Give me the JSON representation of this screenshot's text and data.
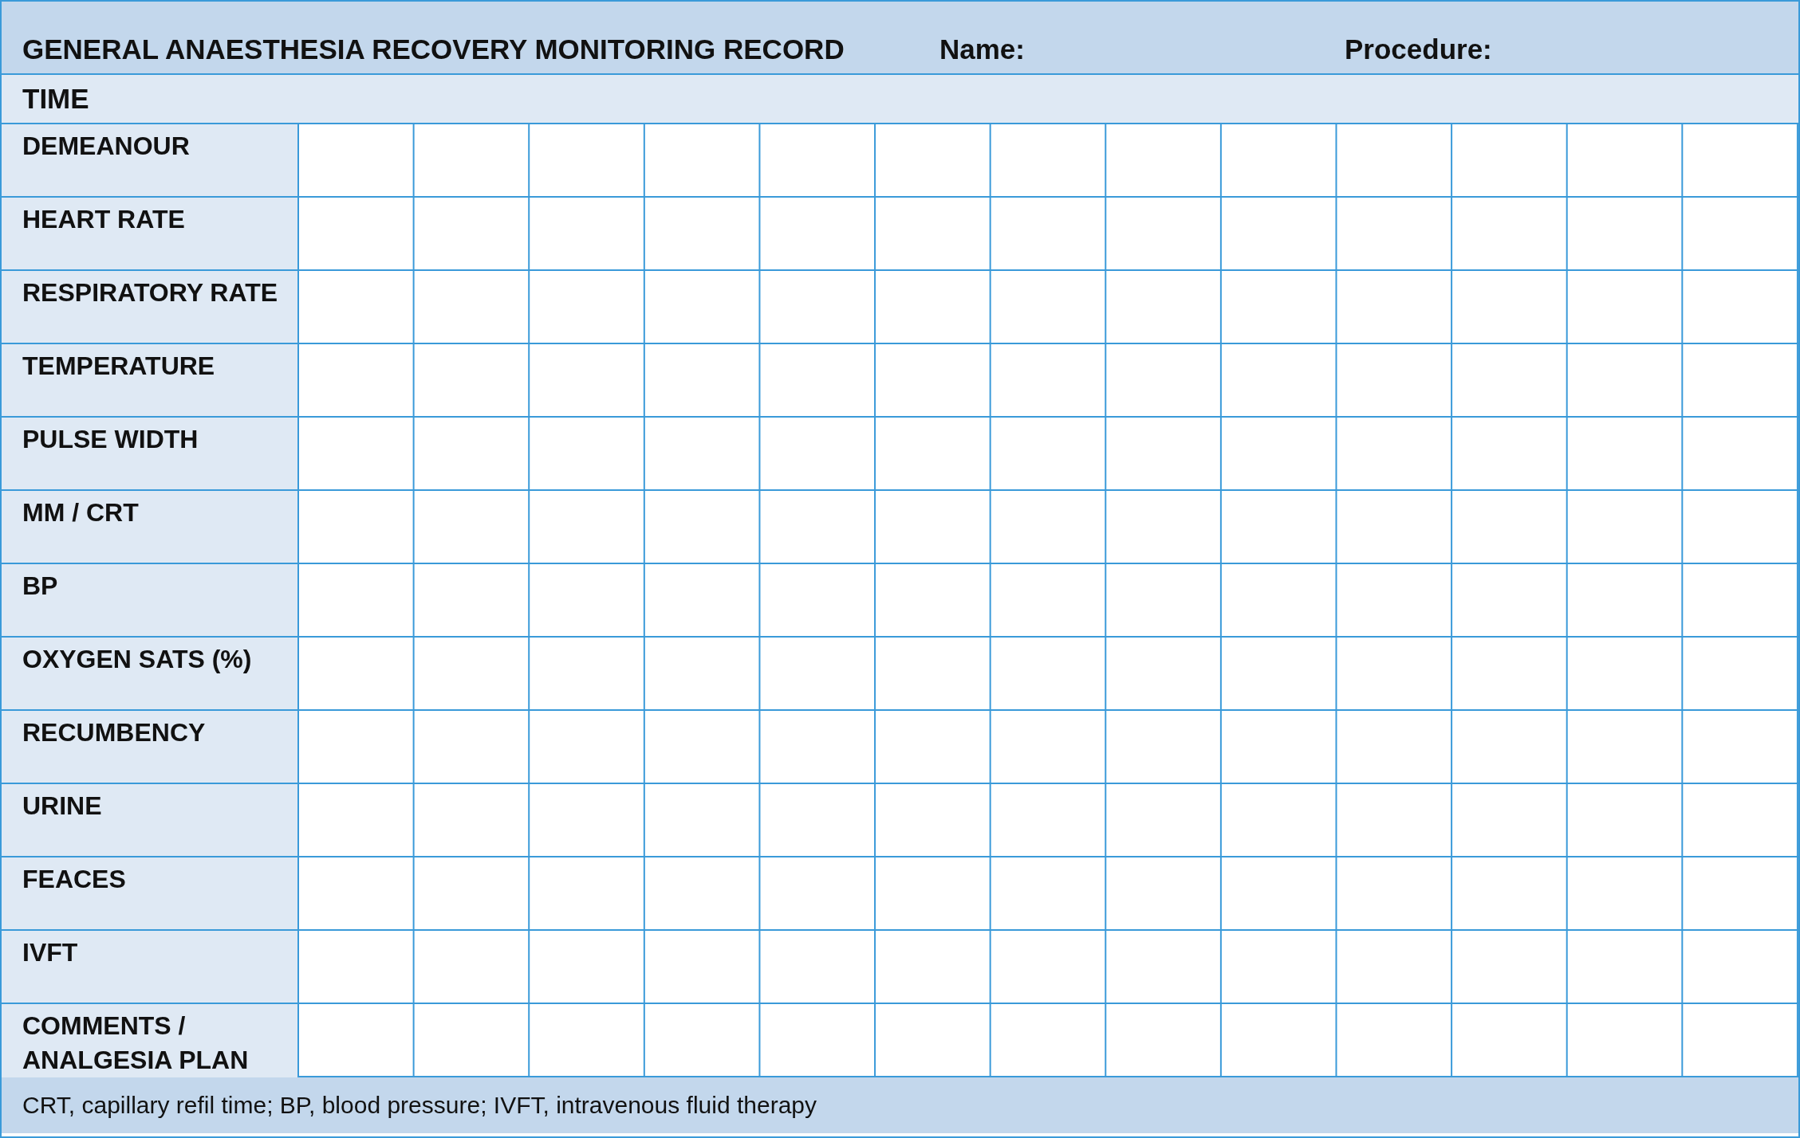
{
  "header": {
    "title": "GENERAL ANAESTHESIA RECOVERY MONITORING RECORD",
    "name_label": "Name:",
    "procedure_label": "Procedure:"
  },
  "time_row": {
    "label": "TIME"
  },
  "rows": [
    {
      "label": "DEMEANOUR"
    },
    {
      "label": "HEART RATE"
    },
    {
      "label": "RESPIRATORY RATE"
    },
    {
      "label": "TEMPERATURE"
    },
    {
      "label": "PULSE WIDTH"
    },
    {
      "label": "MM / CRT"
    },
    {
      "label": "BP"
    },
    {
      "label": "OXYGEN SATS (%)"
    },
    {
      "label": "RECUMBENCY"
    },
    {
      "label": "URINE"
    },
    {
      "label": "FEACES"
    },
    {
      "label": "IVFT"
    },
    {
      "label": "COMMENTS / ANALGESIA PLAN"
    }
  ],
  "footnote": "CRT, capillary refil time; BP, blood pressure; IVFT, intravenous fluid therapy"
}
